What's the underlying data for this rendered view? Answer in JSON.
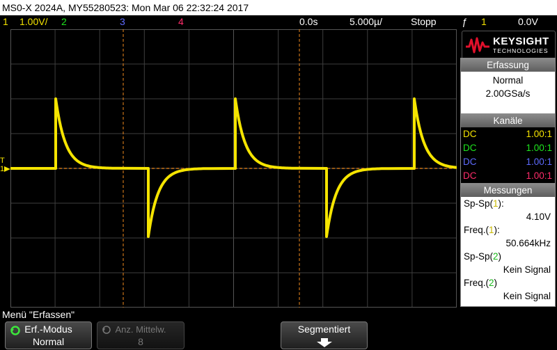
{
  "title_bar": {
    "text": "MS0-X 2024A, MY55280523: Mon Mar 06 22:32:24 2017"
  },
  "status": {
    "ch1_num": "1",
    "ch1_scale": "1.00V/",
    "ch2_num": "2",
    "ch3_num": "3",
    "ch4_num": "4",
    "time_offset": "0.0s",
    "time_scale": "5.000µ/",
    "run_state": "Stopp",
    "trigger_icon": "ƒ",
    "trigger_ch": "1",
    "trigger_level": "0.0V"
  },
  "colors": {
    "ch1": "#f5e400",
    "ch2": "#1ee61e",
    "ch3": "#5e6bff",
    "ch4": "#ff2c6a",
    "grid": "#444444",
    "cursor": "#f08a1c",
    "brand": "#e0102b"
  },
  "screen": {
    "ground_marker": "1",
    "trigger_marker": "T"
  },
  "logo": {
    "name": "KEYSIGHT",
    "sub": "TECHNOLOGIES"
  },
  "erfassung": {
    "header": "Erfassung",
    "mode": "Normal",
    "rate": "2.00GSa/s"
  },
  "kanale": {
    "header": "Kanäle",
    "rows": [
      {
        "coupling": "DC",
        "probe": "1.00:1"
      },
      {
        "coupling": "DC",
        "probe": "1.00:1"
      },
      {
        "coupling": "DC",
        "probe": "1.00:1"
      },
      {
        "coupling": "DC",
        "probe": "1.00:1"
      }
    ]
  },
  "messungen": {
    "header": "Messungen",
    "items": [
      {
        "pre": "Sp-Sp(",
        "ch": "1",
        "post": "):",
        "value": "4.10V"
      },
      {
        "pre": "Freq.(",
        "ch": "1",
        "post": "):",
        "value": "50.664kHz"
      },
      {
        "pre": "Sp-Sp(",
        "ch": "2",
        "post": ")",
        "value": "Kein Signal"
      },
      {
        "pre": "Freq.(",
        "ch": "2",
        "post": ")",
        "value": "Kein Signal"
      }
    ]
  },
  "menu": {
    "title": "Menü \"Erfassen\""
  },
  "softkeys": {
    "erf_modus_label": "Erf.-Modus",
    "erf_modus_value": "Normal",
    "anz_label": "Anz. Mittelw.",
    "anz_value": "8",
    "segment_label": "Segmentiert"
  }
}
